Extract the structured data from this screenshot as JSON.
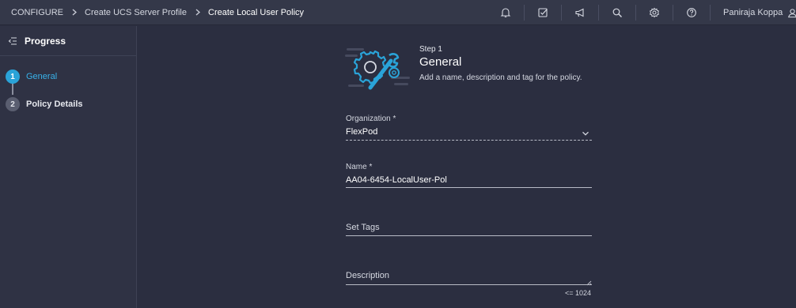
{
  "breadcrumb": {
    "items": [
      "CONFIGURE",
      "Create UCS Server Profile",
      "Create Local User Policy"
    ]
  },
  "header": {
    "icons": [
      "bell-icon",
      "task-check-icon",
      "megaphone-icon",
      "search-icon",
      "gear-icon",
      "help-icon"
    ],
    "user_name": "Paniraja Koppa"
  },
  "sidebar": {
    "title": "Progress",
    "steps": [
      {
        "number": "1",
        "label": "General",
        "active": true
      },
      {
        "number": "2",
        "label": "Policy Details",
        "active": false
      }
    ]
  },
  "main": {
    "step_kicker": "Step 1",
    "step_title": "General",
    "step_description": "Add a name, description and tag for the policy.",
    "organization": {
      "label": "Organization *",
      "value": "FlexPod"
    },
    "name": {
      "label": "Name *",
      "value": "AA04-6454-LocalUser-Pol"
    },
    "tags": {
      "placeholder": "Set Tags"
    },
    "description": {
      "placeholder": "Description",
      "counter": "<= 1024"
    }
  },
  "colors": {
    "accent": "#2aa3d8",
    "background": "#2b2e40",
    "header": "#343849"
  }
}
